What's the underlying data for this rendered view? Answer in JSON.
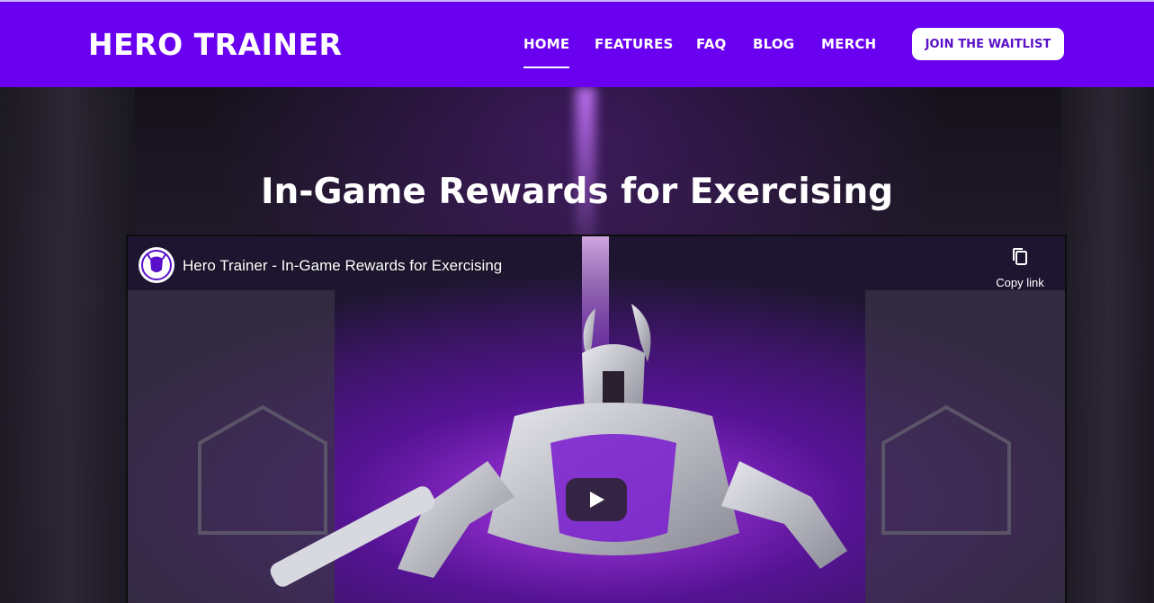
{
  "brand": {
    "name": "HERO TRAINER"
  },
  "nav": {
    "items": [
      {
        "label": "HOME",
        "active": true
      },
      {
        "label": "FEATURES",
        "active": false
      },
      {
        "label": "FAQ",
        "active": false
      },
      {
        "label": "BLOG",
        "active": false
      },
      {
        "label": "MERCH",
        "active": false
      }
    ],
    "cta_label": "JOIN THE WAITLIST"
  },
  "hero": {
    "title": "In-Game Rewards for Exercising"
  },
  "video": {
    "title": "Hero Trainer - In-Game Rewards for Exercising",
    "copy_link_label": "Copy link",
    "icons": [
      "channel-avatar-icon",
      "copy-icon",
      "play-icon"
    ]
  },
  "colors": {
    "header_bg": "#6a00f0",
    "cta_text": "#5a10c8",
    "accent_purple": "#a020f0"
  }
}
